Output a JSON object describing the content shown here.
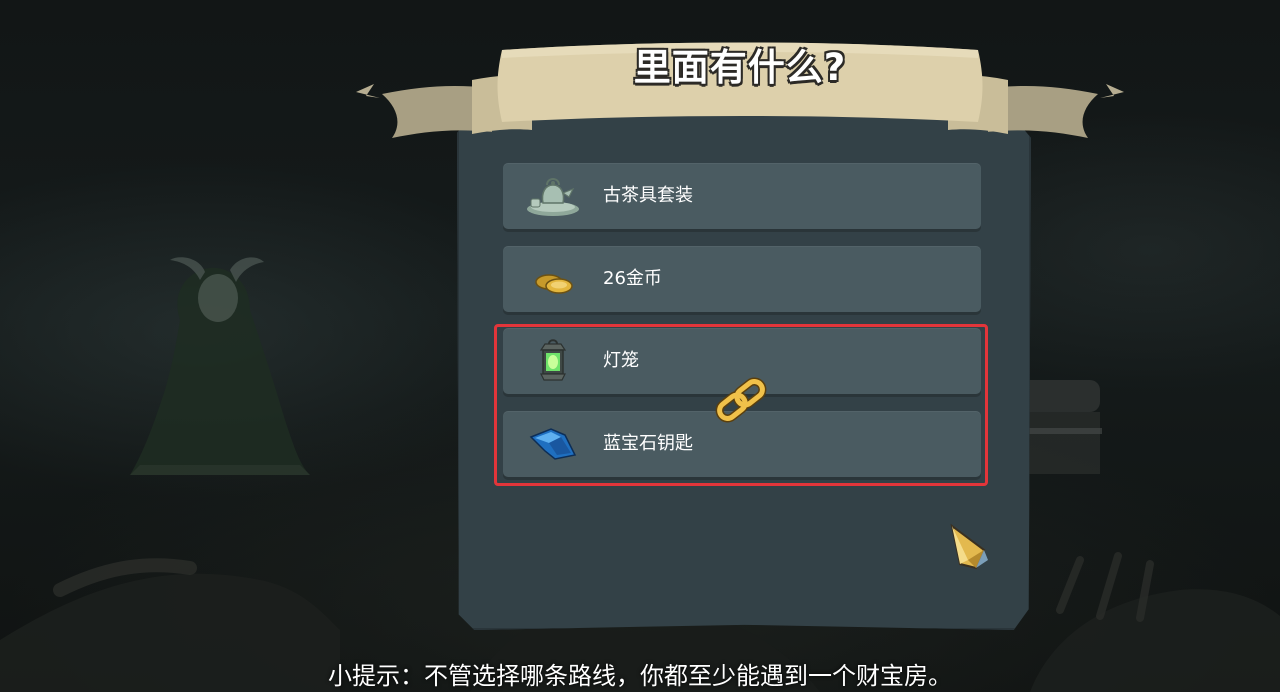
{
  "dialog": {
    "title": "里面有什么?",
    "items": [
      {
        "label": "古茶具套装",
        "icon": "teapot-icon"
      },
      {
        "label": "26金币",
        "icon": "gold-coins-icon"
      },
      {
        "label": "灯笼",
        "icon": "lantern-icon"
      },
      {
        "label": "蓝宝石钥匙",
        "icon": "sapphire-key-icon"
      }
    ],
    "linked_items": [
      "灯笼",
      "蓝宝石钥匙"
    ],
    "highlight_color": "#e3353a"
  },
  "hint": "小提示：不管选择哪条路线，你都至少能遇到一个财宝房。",
  "colors": {
    "panel": "#334147",
    "item": "#4a5b61",
    "banner": "#d9cba4"
  }
}
